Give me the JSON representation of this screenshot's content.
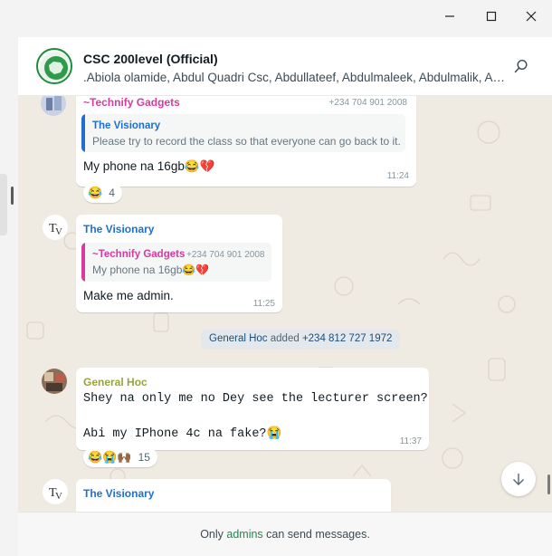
{
  "window": {
    "minimize_icon": "minimize-icon",
    "maximize_icon": "maximize-icon",
    "close_icon": "close-icon"
  },
  "header": {
    "title": "CSC 200level (Official)",
    "members": ".Abiola olamide, Abdul Quadri Csc, Abdullateef, Abdulmaleek, Abdulmalik, Abdulrahman",
    "search_icon": "search-icon"
  },
  "colors": {
    "technify": "#d83aa0",
    "visionary": "#1f6fd1",
    "general_hoc": "#97a43a",
    "admins_green": "#1c8a4e",
    "chat_bg": "#efeae2"
  },
  "messages": [
    {
      "sender": "~Technify Gadgets",
      "phone": "+234 704 901 2008",
      "quote_name": "The Visionary",
      "quote_text": "Please try to record the class so that everyone can go back to it.",
      "text": "My phone na 16gb😂💔",
      "time": "11:24",
      "reactions": "😂",
      "reaction_count": "4"
    },
    {
      "sender": "The Visionary",
      "quote_name": "~Technify Gadgets",
      "quote_phone": "+234 704 901 2008",
      "quote_text": "My phone na 16gb😂💔",
      "text": "Make me admin.",
      "time": "11:25"
    },
    {
      "sender": "General Hoc",
      "line1": "Shey na only me no Dey see the lecturer screen?",
      "line2": "Abi my IPhone 4c na fake?😭",
      "time": "11:37",
      "reactions": "😂😭🙌🏾",
      "reaction_count": "15"
    },
    {
      "sender": "The Visionary"
    }
  ],
  "system_message": {
    "actor": "General Hoc",
    "action": " added ",
    "target": "+234 812 727 1972"
  },
  "footer": {
    "prefix": "Only ",
    "highlight": "admins",
    "suffix": " can send messages."
  }
}
